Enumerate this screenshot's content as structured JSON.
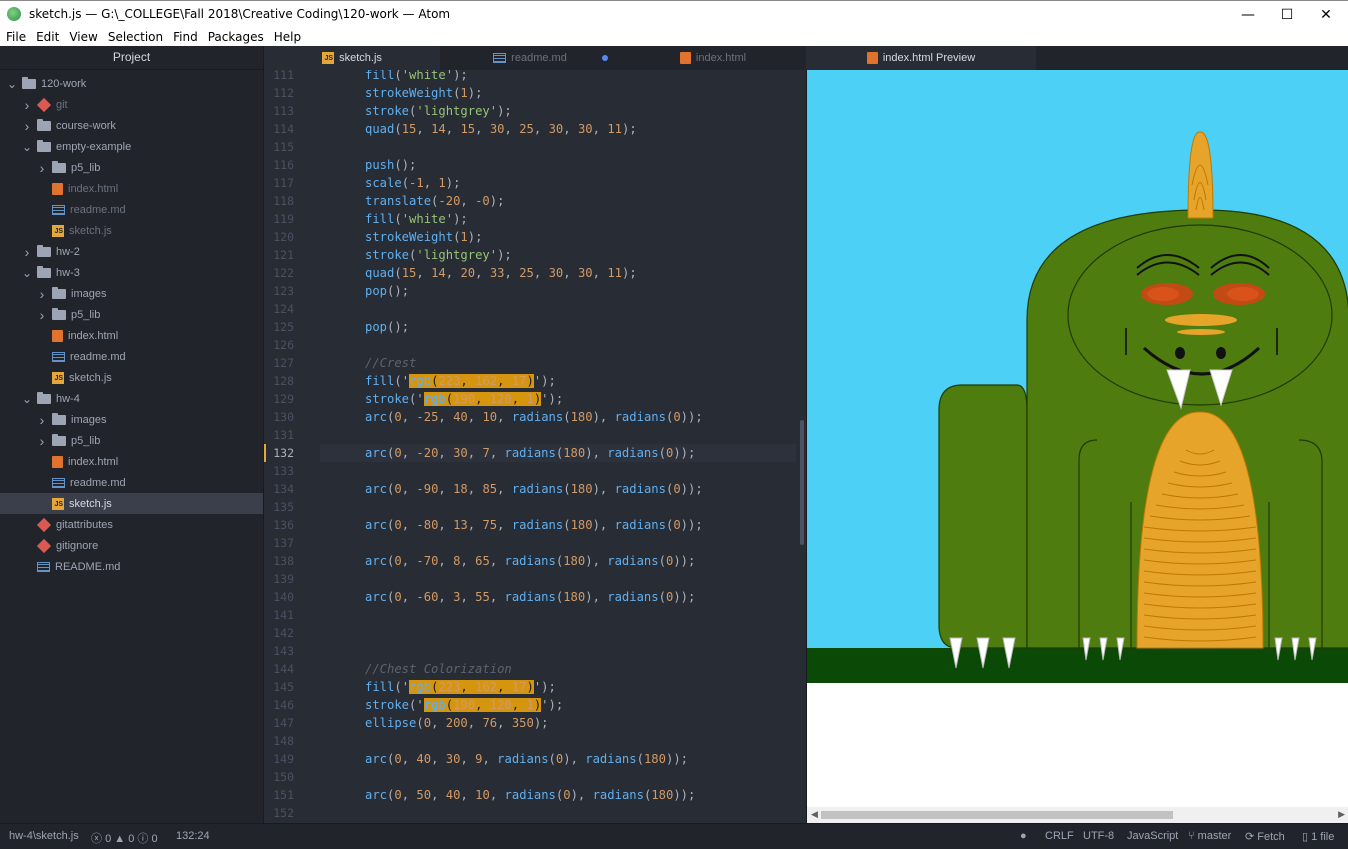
{
  "window": {
    "title": "sketch.js — G:\\_COLLEGE\\Fall 2018\\Creative Coding\\120-work — Atom",
    "minimize_glyph": "—",
    "maximize_glyph": "☐",
    "close_glyph": "✕"
  },
  "menu": [
    "File",
    "Edit",
    "View",
    "Selection",
    "Find",
    "Packages",
    "Help"
  ],
  "sidebar": {
    "title": "Project",
    "items": [
      {
        "label": "120-work",
        "type": "folder",
        "depth": 0,
        "expanded": true
      },
      {
        "label": "git",
        "type": "git",
        "depth": 1,
        "collapsible": true,
        "dim": true
      },
      {
        "label": "course-work",
        "type": "folder",
        "depth": 1
      },
      {
        "label": "empty-example",
        "type": "folder",
        "depth": 1,
        "expanded": true
      },
      {
        "label": "p5_lib",
        "type": "folder",
        "depth": 2
      },
      {
        "label": "index.html",
        "type": "html",
        "depth": 2,
        "dim": true
      },
      {
        "label": "readme.md",
        "type": "md",
        "depth": 2,
        "dim": true
      },
      {
        "label": "sketch.js",
        "type": "js",
        "depth": 2,
        "dim": true
      },
      {
        "label": "hw-2",
        "type": "folder",
        "depth": 1
      },
      {
        "label": "hw-3",
        "type": "folder",
        "depth": 1,
        "expanded": true
      },
      {
        "label": "images",
        "type": "folder",
        "depth": 2
      },
      {
        "label": "p5_lib",
        "type": "folder",
        "depth": 2
      },
      {
        "label": "index.html",
        "type": "html",
        "depth": 2
      },
      {
        "label": "readme.md",
        "type": "md",
        "depth": 2
      },
      {
        "label": "sketch.js",
        "type": "js",
        "depth": 2
      },
      {
        "label": "hw-4",
        "type": "folder",
        "depth": 1,
        "expanded": true
      },
      {
        "label": "images",
        "type": "folder",
        "depth": 2
      },
      {
        "label": "p5_lib",
        "type": "folder",
        "depth": 2
      },
      {
        "label": "index.html",
        "type": "html",
        "depth": 2
      },
      {
        "label": "readme.md",
        "type": "md",
        "depth": 2
      },
      {
        "label": "sketch.js",
        "type": "js",
        "depth": 2,
        "selected": true
      },
      {
        "label": "gitattributes",
        "type": "git",
        "depth": 1
      },
      {
        "label": "gitignore",
        "type": "git",
        "depth": 1
      },
      {
        "label": "README.md",
        "type": "md",
        "depth": 1
      }
    ]
  },
  "tabs": [
    {
      "label": "sketch.js",
      "type": "js",
      "active": true
    },
    {
      "label": "readme.md",
      "type": "md",
      "modified": true
    },
    {
      "label": "index.html",
      "type": "html"
    },
    {
      "label": "index.html Preview",
      "type": "html",
      "active": true
    }
  ],
  "editor": {
    "current_line": "132",
    "lines": [
      {
        "n": "111",
        "code": "    fill('white');"
      },
      {
        "n": "112",
        "code": "    strokeWeight(1);"
      },
      {
        "n": "113",
        "code": "    stroke('lightgrey');"
      },
      {
        "n": "114",
        "code": "    quad(15, 14, 15, 30, 25, 30, 30, 11);"
      },
      {
        "n": "115",
        "code": ""
      },
      {
        "n": "116",
        "code": "    push();"
      },
      {
        "n": "117",
        "code": "    scale(-1, 1);"
      },
      {
        "n": "118",
        "code": "    translate(-20, -0);"
      },
      {
        "n": "119",
        "code": "    fill('white');"
      },
      {
        "n": "120",
        "code": "    strokeWeight(1);"
      },
      {
        "n": "121",
        "code": "    stroke('lightgrey');"
      },
      {
        "n": "122",
        "code": "    quad(15, 14, 20, 33, 25, 30, 30, 11);"
      },
      {
        "n": "123",
        "code": "    pop();"
      },
      {
        "n": "124",
        "code": ""
      },
      {
        "n": "125",
        "code": "    pop();"
      },
      {
        "n": "126",
        "code": ""
      },
      {
        "n": "127",
        "code": "    //Crest"
      },
      {
        "n": "128",
        "code": "    fill('rgb(223, 162, 17)');"
      },
      {
        "n": "129",
        "code": "    stroke('rgb(190, 120, 1)');"
      },
      {
        "n": "130",
        "code": "    arc(0, -25, 40, 10, radians(180), radians(0));"
      },
      {
        "n": "131",
        "code": ""
      },
      {
        "n": "132",
        "code": "    arc(0, -20, 30, 7, radians(180), radians(0));"
      },
      {
        "n": "133",
        "code": ""
      },
      {
        "n": "134",
        "code": "    arc(0, -90, 18, 85, radians(180), radians(0));"
      },
      {
        "n": "135",
        "code": ""
      },
      {
        "n": "136",
        "code": "    arc(0, -80, 13, 75, radians(180), radians(0));"
      },
      {
        "n": "137",
        "code": ""
      },
      {
        "n": "138",
        "code": "    arc(0, -70, 8, 65, radians(180), radians(0));"
      },
      {
        "n": "139",
        "code": ""
      },
      {
        "n": "140",
        "code": "    arc(0, -60, 3, 55, radians(180), radians(0));"
      },
      {
        "n": "141",
        "code": ""
      },
      {
        "n": "142",
        "code": ""
      },
      {
        "n": "143",
        "code": ""
      },
      {
        "n": "144",
        "code": "    //Chest Colorization"
      },
      {
        "n": "145",
        "code": "    fill('rgb(223, 162, 17)');"
      },
      {
        "n": "146",
        "code": "    stroke('rgb(190, 120, 1)');"
      },
      {
        "n": "147",
        "code": "    ellipse(0, 200, 76, 350);"
      },
      {
        "n": "148",
        "code": ""
      },
      {
        "n": "149",
        "code": "    arc(0, 40, 30, 9, radians(0), radians(180));"
      },
      {
        "n": "150",
        "code": ""
      },
      {
        "n": "151",
        "code": "    arc(0, 50, 40, 10, radians(0), radians(180));"
      },
      {
        "n": "152",
        "code": ""
      }
    ]
  },
  "preview": {
    "sky_color": "#4dd0f5",
    "ground_color": "#0b4a06",
    "body_color": "#4e7c0e",
    "chest_color": "#e6a52a",
    "eye_color": "#d9521a"
  },
  "status": {
    "path": "hw-4\\sketch.js",
    "errors": "0",
    "warnings": "0",
    "infos": "0",
    "cursor": "132:24",
    "line_ending": "CRLF",
    "encoding": "UTF-8",
    "grammar": "JavaScript",
    "branch": "master",
    "fetch": "Fetch",
    "files": "1 file"
  }
}
